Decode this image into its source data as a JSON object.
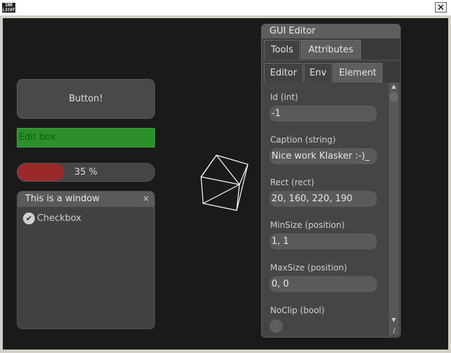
{
  "window": {
    "app_icon": "IRR LICHT",
    "close_icon": "close-icon"
  },
  "widgets": {
    "button_label": "Button!",
    "editbox_value": "Edit box",
    "progress_text": "35 %",
    "progress_value": 0.35
  },
  "demo_window": {
    "title": "This is a window",
    "close_glyph": "×",
    "checkbox_glyph": "✔",
    "checkbox_label": "Checkbox"
  },
  "gui_editor": {
    "title": "GUI Editor",
    "tabs": [
      "Tools",
      "Attributes"
    ],
    "subtabs": [
      "Editor",
      "Env",
      "Element"
    ],
    "attributes": [
      {
        "label": "Id (int)",
        "value": "-1"
      },
      {
        "label": "Caption (string)",
        "value": "Nice work Klasker :-)_"
      },
      {
        "label": "Rect (rect)",
        "value": "20, 160, 220, 190"
      },
      {
        "label": "MinSize (position)",
        "value": "1, 1"
      },
      {
        "label": "MaxSize (position)",
        "value": "0, 0"
      },
      {
        "label": "NoClip (bool)",
        "value": ""
      }
    ],
    "scroll_up": "▲",
    "scroll_down": "▼",
    "resize_grip": "/"
  }
}
